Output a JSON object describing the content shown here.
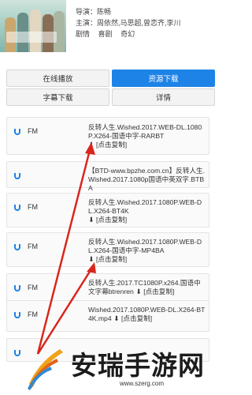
{
  "meta": {
    "director": "导演：陈畅",
    "actors": "主演：周依然,马思超,曾恋齐,李川",
    "genres": [
      "剧情",
      "喜剧",
      "奇幻"
    ]
  },
  "buttons": {
    "online": "在线播放",
    "download": "资源下载",
    "subtitle": "字幕下载",
    "detail": "详情"
  },
  "list": [
    {
      "label": "FM",
      "title": "反转人生.Wished.2017.WEB-DL.1080P.X264-国语中字-RARBT",
      "copy": "[点击复制]"
    },
    {
      "label": "",
      "title": "【BTD-www.bpzhe.com.cn】反转人生.Wished.2017.1080p国语中英双字.BTBA",
      "copy": ""
    },
    {
      "label": "FM",
      "title": "反转人生.Wished.2017.1080P.WEB-DL.X264-BT4K",
      "copy": "[点击复制]"
    },
    {
      "label": "FM",
      "title": "反转人生.Wished.2017.1080P.WEB-DL.X264-国语中字-MP4BA",
      "copy": "[点击复制]"
    },
    {
      "label": "FM",
      "title": "反转人生.2017.TC1080P.x264.国语中文字幕btrenren",
      "copy": "[点击复制]"
    },
    {
      "label": "FM",
      "title": "Wished.2017.1080P.WEB-DL.X264-BT4K.mp4",
      "copy": "[点击复制]"
    },
    {
      "label": "",
      "title": "",
      "copy": ""
    }
  ],
  "watermark": {
    "brand": "安瑞手游网",
    "url": "www.szerg.com"
  },
  "colors": {
    "accent": "#1e83e6",
    "arrow": "#d9261c"
  }
}
